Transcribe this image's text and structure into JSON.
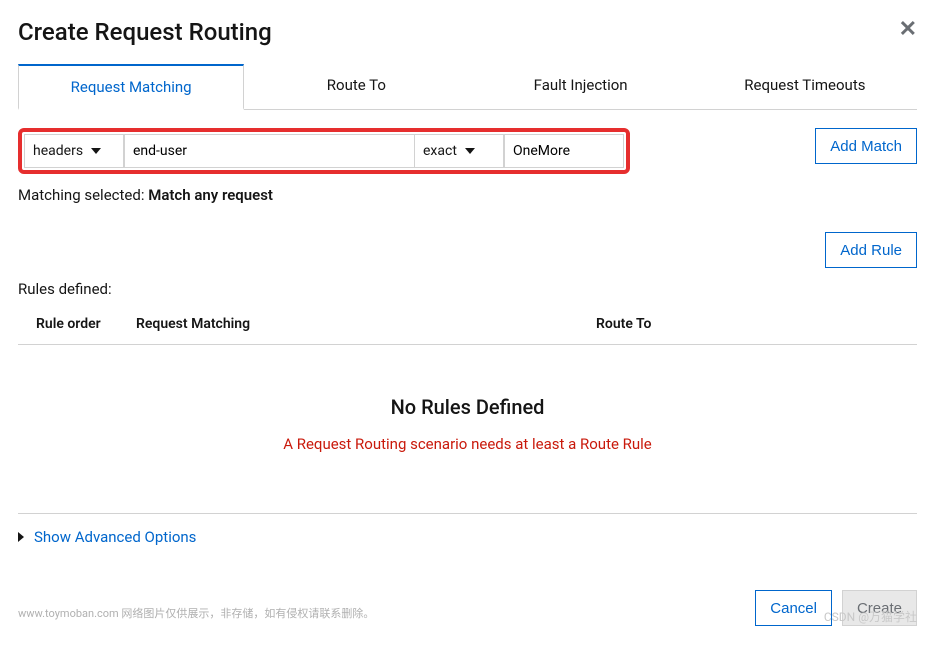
{
  "modal": {
    "title": "Create Request Routing"
  },
  "tabs": {
    "items": [
      {
        "label": "Request Matching",
        "active": true
      },
      {
        "label": "Route To",
        "active": false
      },
      {
        "label": "Fault Injection",
        "active": false
      },
      {
        "label": "Request Timeouts",
        "active": false
      }
    ]
  },
  "match": {
    "type": "headers",
    "key": "end-user",
    "operator": "exact",
    "value": "OneMore",
    "add_match_label": "Add Match"
  },
  "matching_selected": {
    "prefix": "Matching selected: ",
    "value": "Match any request"
  },
  "rules": {
    "add_rule_label": "Add Rule",
    "defined_label": "Rules defined:",
    "columns": {
      "order": "Rule order",
      "matching": "Request Matching",
      "route": "Route To"
    },
    "empty_title": "No Rules Defined",
    "empty_desc": "A Request Routing scenario needs at least a Route Rule"
  },
  "advanced": {
    "label": "Show Advanced Options"
  },
  "footer": {
    "cancel": "Cancel",
    "create": "Create"
  },
  "meta": {
    "footer_note": "www.toymoban.com 网络图片仅供展示，非存储，如有侵权请联系删除。",
    "watermark": "CSDN @万猫学社"
  }
}
